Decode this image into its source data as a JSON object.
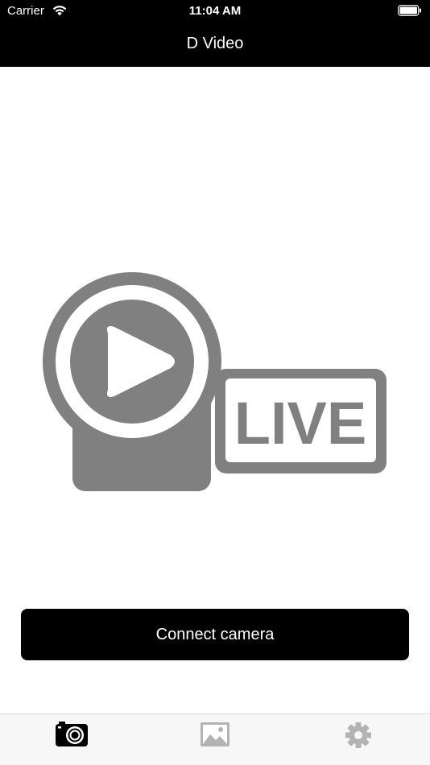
{
  "status_bar": {
    "carrier": "Carrier",
    "time": "11:04 AM",
    "wifi_icon": "wifi-icon",
    "battery_icon": "battery-icon"
  },
  "nav": {
    "title": "D Video"
  },
  "main": {
    "graphic_icon": "live-video-icon",
    "graphic_text": "LIVE",
    "graphic_color": "#808080",
    "connect_button_label": "Connect camera"
  },
  "tabs": [
    {
      "icon": "camera-icon",
      "selected": true,
      "color": "#000000"
    },
    {
      "icon": "image-icon",
      "selected": false,
      "color": "#b3b3b3"
    },
    {
      "icon": "gear-icon",
      "selected": false,
      "color": "#b3b3b3"
    }
  ]
}
